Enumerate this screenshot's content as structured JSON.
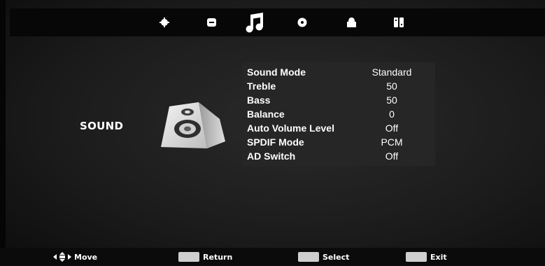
{
  "tabs": [
    {
      "icon": "picture-icon",
      "selected": false
    },
    {
      "icon": "channel-icon",
      "selected": false
    },
    {
      "icon": "music-note-icon",
      "selected": true
    },
    {
      "icon": "time-icon",
      "selected": false
    },
    {
      "icon": "lock-icon",
      "selected": false
    },
    {
      "icon": "setup-icon",
      "selected": false
    }
  ],
  "section_title": "SOUND",
  "section_icon": "speaker-icon",
  "menu": {
    "items": [
      {
        "label": "Sound Mode",
        "value": "Standard"
      },
      {
        "label": "Treble",
        "value": "50"
      },
      {
        "label": "Bass",
        "value": "50"
      },
      {
        "label": "Balance",
        "value": "0"
      },
      {
        "label": "Auto Volume Level",
        "value": "Off"
      },
      {
        "label": "SPDIF Mode",
        "value": "PCM"
      },
      {
        "label": "AD Switch",
        "value": "Off"
      }
    ]
  },
  "hints": {
    "move": "Move",
    "return": "Return",
    "select": "Select",
    "exit": "Exit"
  }
}
